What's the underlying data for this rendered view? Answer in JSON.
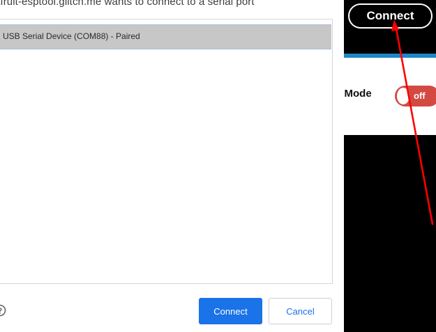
{
  "dialog": {
    "title": "afruit-esptool.glitch.me wants to connect to a serial port",
    "ports": [
      {
        "label": "USB Serial Device (COM88) - Paired"
      }
    ],
    "connect_label": "Connect",
    "cancel_label": "Cancel",
    "help_icon": "help-circle-icon"
  },
  "app": {
    "connect_label": "Connect",
    "mode_label": "k Mode",
    "toggle_state": "off"
  },
  "annotation": {
    "type": "arrow",
    "color": "#ff0000"
  },
  "colors": {
    "primary_button": "#1a73e8",
    "selected_row": "#c7c7c7",
    "toggle_off": "#d24a42",
    "accent_bar": "#1f86c9",
    "app_background": "#000000"
  }
}
